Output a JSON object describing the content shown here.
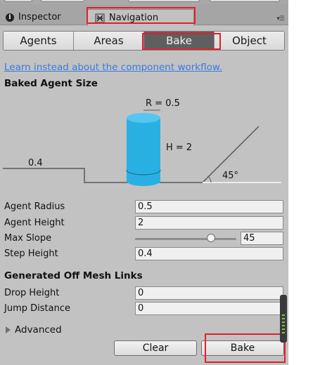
{
  "tabs": {
    "inspector": "Inspector",
    "navigation": "Navigation"
  },
  "segments": [
    "Agents",
    "Areas",
    "Bake",
    "Object"
  ],
  "active_segment": "Bake",
  "link_text": "Learn instead about the component workflow.",
  "baked_agent_size": {
    "title": "Baked Agent Size",
    "diagram": {
      "radius_label": "R = 0.5",
      "height_label": "H = 2",
      "step_label": "0.4",
      "slope_label": "45°"
    },
    "fields": [
      {
        "label": "Agent Radius",
        "value": "0.5"
      },
      {
        "label": "Agent Height",
        "value": "2"
      },
      {
        "label": "Max Slope",
        "value": "45",
        "slider_fraction": 0.75
      },
      {
        "label": "Step Height",
        "value": "0.4"
      }
    ]
  },
  "off_mesh": {
    "title": "Generated Off Mesh Links",
    "fields": [
      {
        "label": "Drop Height",
        "value": "0"
      },
      {
        "label": "Jump Distance",
        "value": "0"
      }
    ]
  },
  "advanced_label": "Advanced",
  "buttons": {
    "clear": "Clear",
    "bake": "Bake"
  },
  "colors": {
    "panel": "#c2c2c2",
    "accent_cylinder": "#29b0e3",
    "link": "#3a7be0",
    "highlight_box": "#e0202a"
  }
}
